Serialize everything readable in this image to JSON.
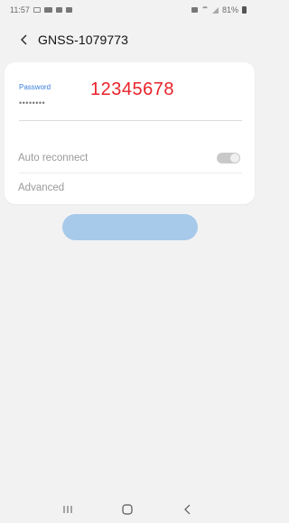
{
  "status_bar": {
    "time": "11:57",
    "battery": "81%"
  },
  "header": {
    "title": "GNSS-1079773"
  },
  "password": {
    "label": "Password",
    "masked_value": "••••••••"
  },
  "annotation": {
    "text": "12345678",
    "color": "#e8232a"
  },
  "settings": {
    "auto_reconnect_label": "Auto reconnect",
    "advanced_label": "Advanced"
  },
  "colors": {
    "accent": "#3a7de0",
    "connect_button": "#a7c9ea",
    "background": "#f2f2f2"
  },
  "nav": {
    "icons": [
      "recent-apps-icon",
      "home-icon",
      "back-icon"
    ]
  }
}
